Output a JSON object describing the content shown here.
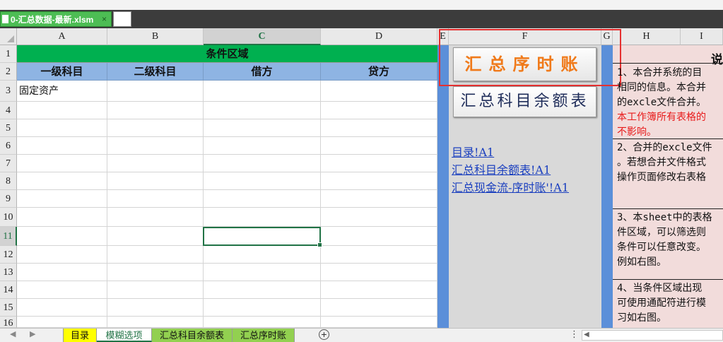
{
  "window": {
    "file_name": "0-汇总数据-最新.xlsm"
  },
  "columns": [
    "A",
    "B",
    "C",
    "D",
    "E",
    "F",
    "G",
    "H",
    "I"
  ],
  "rows": [
    "1",
    "2",
    "3",
    "4",
    "5",
    "6",
    "7",
    "8",
    "9",
    "10",
    "11",
    "12",
    "13",
    "14",
    "15",
    "16"
  ],
  "sheet": {
    "header_title": "条件区域",
    "subheaders": [
      "一级科目",
      "二级科目",
      "借方",
      "贷方"
    ],
    "a3_value": "固定资产"
  },
  "buttons": {
    "summary_ledger": "汇总序时账",
    "summary_balance": "汇总科目余额表"
  },
  "links": [
    "目录!A1",
    "汇总科目余额表!A1",
    "汇总现金流-序时账'!A1"
  ],
  "notes": {
    "title": "说",
    "n1_line1": "1、本合并系统的目",
    "n1_line2": "相同的信息。本合并",
    "n1_line3": "的excle文件合并。",
    "n1_red1": "本工作簿所有表格的",
    "n1_red2": "不影响。",
    "n2_line1": "2、合并的excle文件",
    "n2_line2": "。若想合并文件格式",
    "n2_line3": "操作页面修改右表格",
    "n3_line1": "3、本sheet中的表格",
    "n3_line2": "件区域，可以筛选则",
    "n3_line3": "条件可以任意改变。",
    "n3_line4": "例如右图。",
    "n4_line1": "4、当条件区域出现",
    "n4_line2": "可使用通配符进行模",
    "n4_line3": "习如右图。"
  },
  "sheet_tabs": [
    {
      "label": "目录",
      "color": "#ffff00"
    },
    {
      "label": "模糊选项",
      "color": "#ffffff",
      "active": true
    },
    {
      "label": "汇总科目余额表",
      "color": "#92d050"
    },
    {
      "label": "汇总序时账",
      "color": "#92d050"
    }
  ],
  "colors": {
    "green_header": "#00b050",
    "blue_header": "#8eb4e3",
    "selection": "#217346"
  }
}
